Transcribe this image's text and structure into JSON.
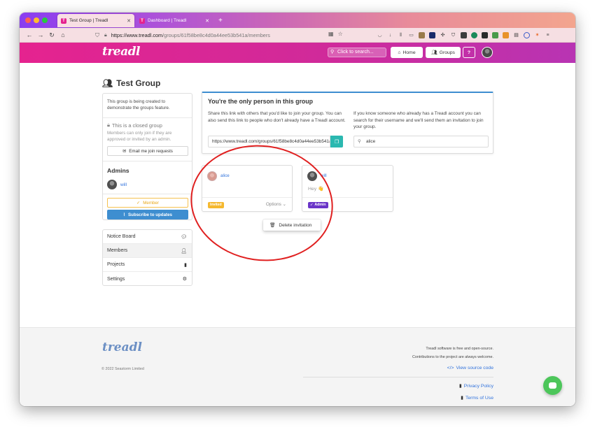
{
  "browser": {
    "tabs": [
      {
        "title": "Test Group | Treadl",
        "active": true
      },
      {
        "title": "Dashboard | Treadl",
        "active": false
      }
    ],
    "url_domain": "https://www.treadl.com",
    "url_path": "/groups/61f58be8c4d0a44ee53b541a/members",
    "traffic_colors": [
      "#fe5f57",
      "#febc2e",
      "#28c840"
    ]
  },
  "header": {
    "logo": "treadl",
    "search_placeholder": "Click to search...",
    "home_label": "Home",
    "groups_label": "Groups",
    "help_label": "?",
    "brand_color": "#e5238f"
  },
  "page": {
    "title": "Test Group"
  },
  "sidebar": {
    "description": "This group is being created to demonstrate the groups feature.",
    "closed_title": "This is a closed group",
    "closed_desc": "Members can only join if they are approved or invited by an admin.",
    "email_btn": "Email me join requests",
    "admins_heading": "Admins",
    "admin_name": "will",
    "member_btn": "Member",
    "subscribe_btn": "Subscribe to updates",
    "menu": [
      {
        "label": "Notice Board",
        "icon": "chat-icon"
      },
      {
        "label": "Members",
        "icon": "user-icon"
      },
      {
        "label": "Projects",
        "icon": "book-icon"
      },
      {
        "label": "Settings",
        "icon": "gears-icon"
      }
    ]
  },
  "info": {
    "title": "You're the only person in this group",
    "left_text": "Share this link with others that you'd like to join your group. You can also send this link to people who don't already have a Treadl account.",
    "right_text": "If you know someone who already has a Treadl account you can search for their username and we'll send them an invitation to join your group.",
    "share_link": "https://www.treadl.com/groups/61f58be8c4d0a44ee53b541a/join",
    "username_value": "alice"
  },
  "members": [
    {
      "name": "alice",
      "note": "",
      "tag": "Invited",
      "tag_color": "#f5b82e",
      "options": "Options"
    },
    {
      "name": "will",
      "note": "Hey 👋",
      "tag": "Admin",
      "tag_color": "#6a35c8"
    }
  ],
  "dropdown": {
    "delete_label": "Delete invitation"
  },
  "footer": {
    "logo": "treadl",
    "copyright": "© 2022 Seastorm Limited",
    "line1": "Treadl software is free and open-source.",
    "line2": "Contributions to the project are always welcome.",
    "source_link": "View source code",
    "privacy_link": "Privacy Policy",
    "terms_link": "Terms of Use"
  }
}
